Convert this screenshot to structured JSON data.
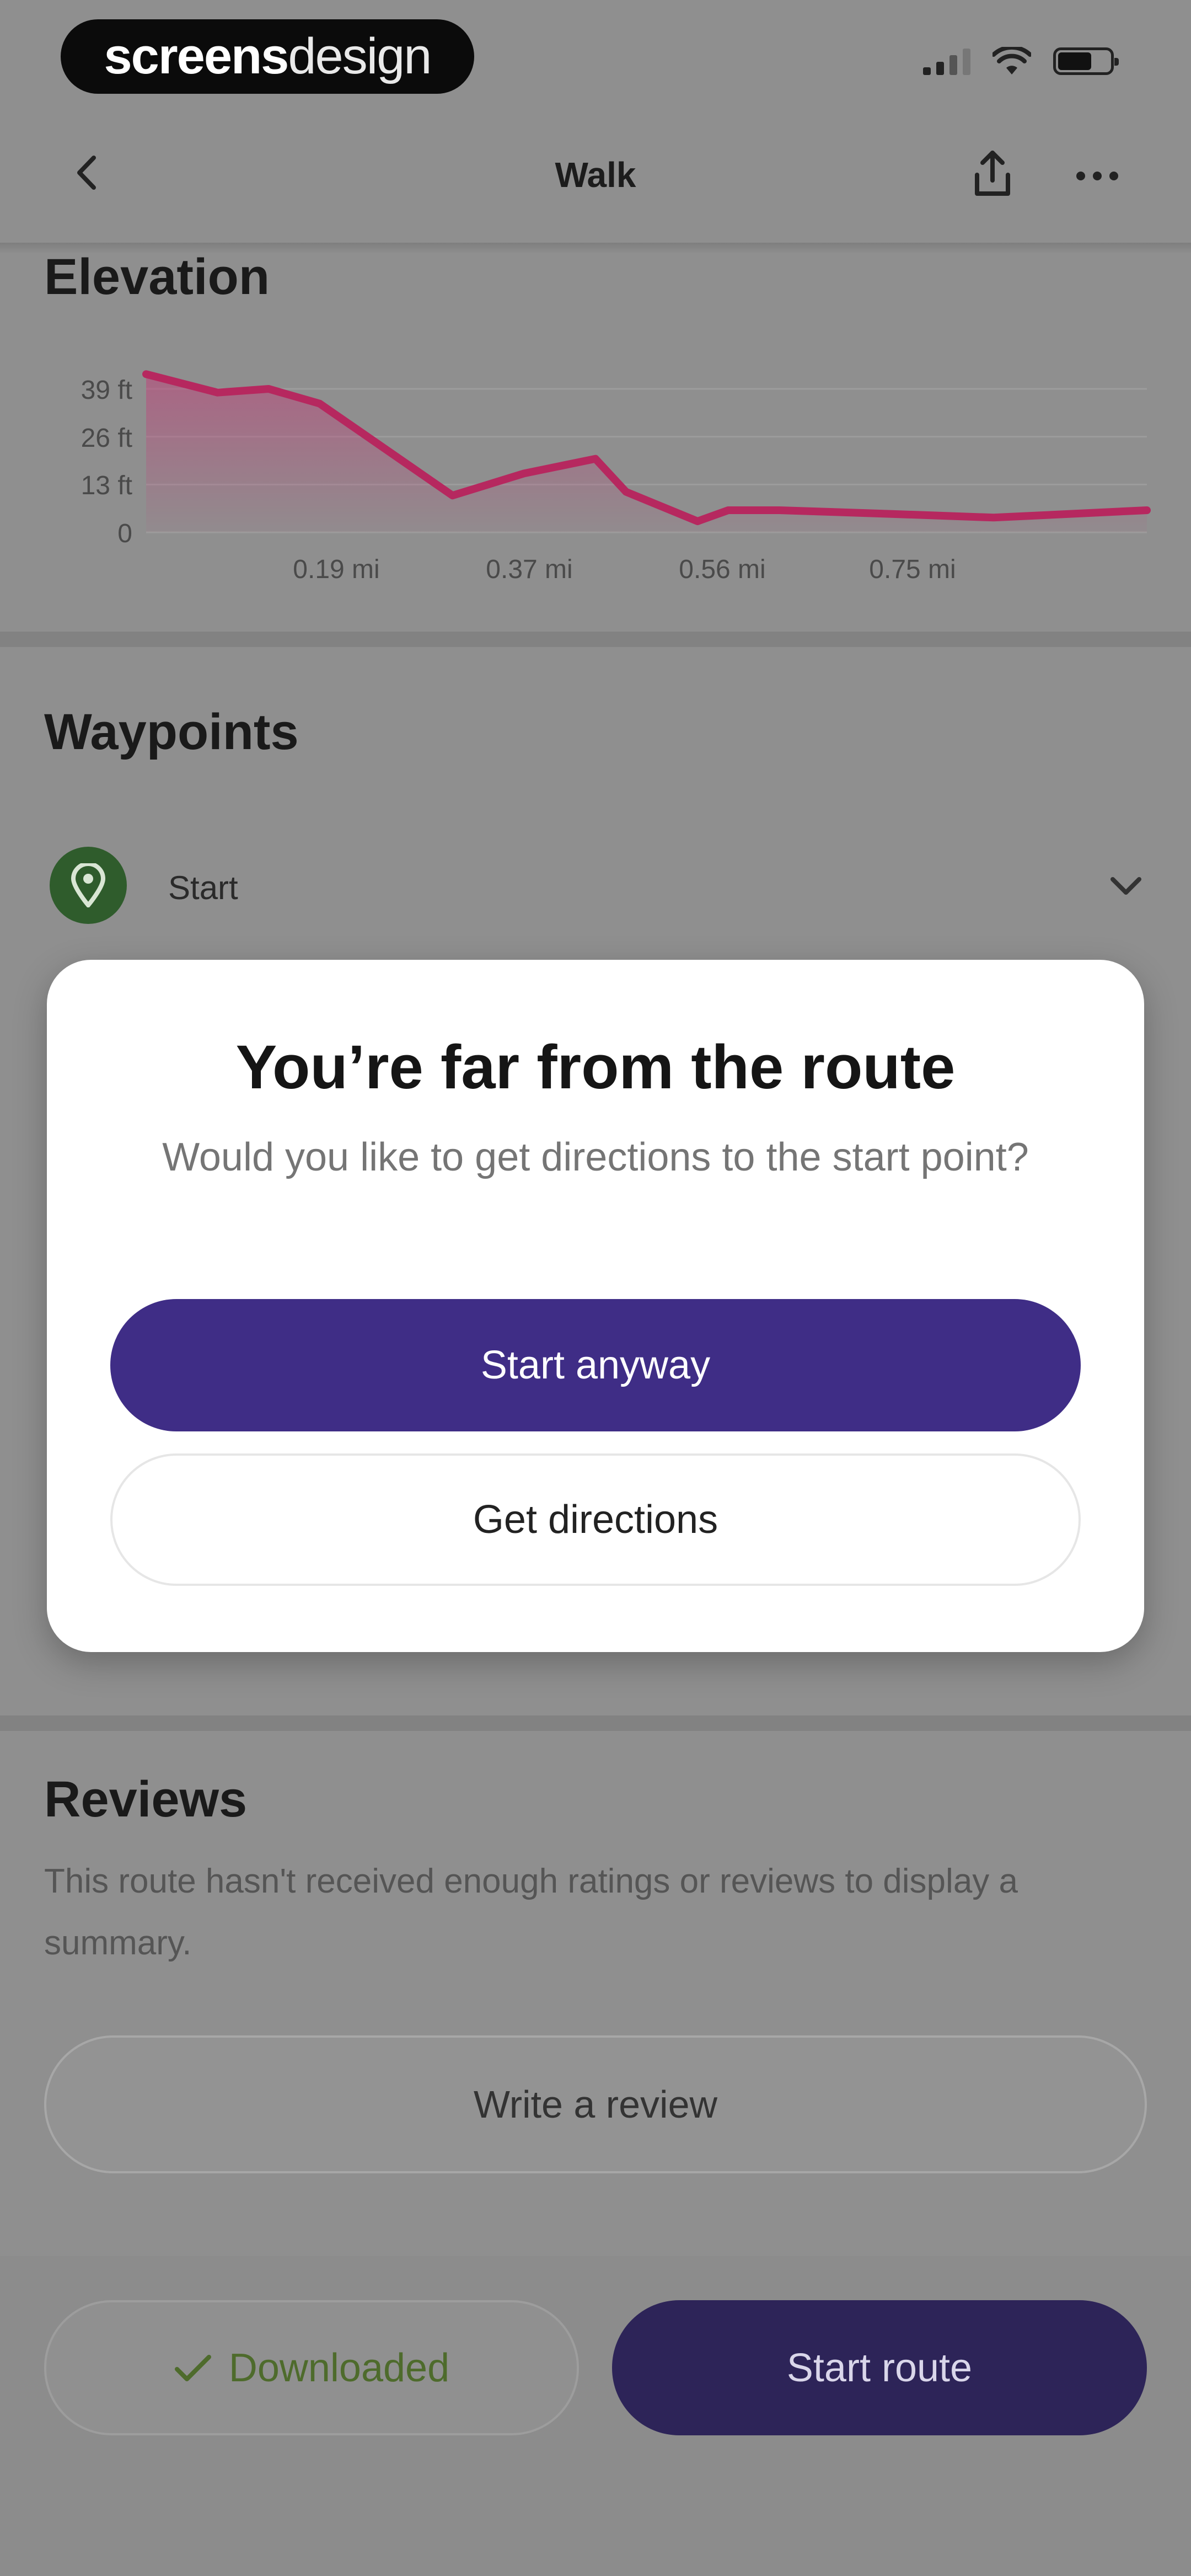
{
  "status_bar": {
    "brand_bold": "screens",
    "brand_light": "design"
  },
  "nav": {
    "title": "Walk",
    "back_icon": "chevron-left-icon",
    "share_icon": "share-icon",
    "more_icon": "more-icon"
  },
  "elevation": {
    "heading": "Elevation"
  },
  "chart_data": {
    "type": "area",
    "title": "Elevation",
    "y_ticks": [
      "39 ft",
      "26 ft",
      "13 ft",
      "0"
    ],
    "x_ticks": [
      "0.19 mi",
      "0.37 mi",
      "0.56 mi",
      "0.75 mi"
    ],
    "ylim": [
      0,
      39
    ],
    "xlim": [
      0,
      0.98
    ],
    "x": [
      0.0,
      0.07,
      0.12,
      0.17,
      0.3,
      0.37,
      0.44,
      0.47,
      0.54,
      0.57,
      0.62,
      0.73,
      0.83,
      0.98
    ],
    "y": [
      43,
      38,
      39,
      35,
      10,
      16,
      20,
      11,
      3,
      6,
      6,
      5,
      4,
      6
    ],
    "grid": true,
    "line_color": "#b6285f",
    "fill_color": "#c0417a"
  },
  "waypoints": {
    "heading": "Waypoints",
    "items": [
      {
        "label": "Start",
        "icon": "map-pin-icon"
      }
    ]
  },
  "modal": {
    "title": "You’re far from the route",
    "body": "Would you like to get directions to the start point?",
    "primary_label": "Start anyway",
    "secondary_label": "Get directions"
  },
  "reviews": {
    "heading": "Reviews",
    "text": "This route hasn't received enough ratings or reviews to display a summary.",
    "write_label": "Write a review"
  },
  "bottom": {
    "downloaded_label": "Downloaded",
    "start_route_label": "Start route"
  },
  "colors": {
    "accent": "#3f2d86",
    "chart_line": "#b6285f",
    "waypoint_green": "#2f5c2c",
    "downloaded_green": "#4e6b2c"
  }
}
